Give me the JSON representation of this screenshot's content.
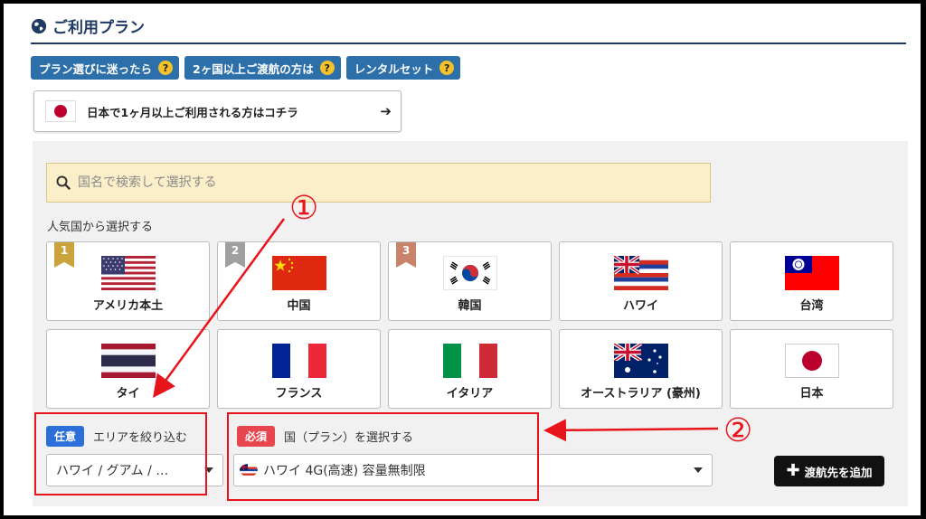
{
  "section": {
    "title": "ご利用プラン",
    "icon": "globe-icon"
  },
  "help_buttons": [
    {
      "label": "プラン選びに迷ったら",
      "icon": "question-icon"
    },
    {
      "label": "2ヶ国以上ご渡航の方は",
      "icon": "question-icon"
    },
    {
      "label": "レンタルセット",
      "icon": "question-icon"
    }
  ],
  "long_stay": {
    "label": "日本で1ヶ月以上ご利用される方はコチラ",
    "arrow": "➔"
  },
  "search": {
    "placeholder": "国名で検索して選択する",
    "icon": "search-icon"
  },
  "popular": {
    "label": "人気国から選択する",
    "countries": [
      {
        "name": "アメリカ本土",
        "rank": "1",
        "rank_color": "#c9a43c",
        "flag": "usa"
      },
      {
        "name": "中国",
        "rank": "2",
        "rank_color": "#a0a0a0",
        "flag": "china"
      },
      {
        "name": "韓国",
        "rank": "3",
        "rank_color": "#c8846a",
        "flag": "korea"
      },
      {
        "name": "ハワイ",
        "rank": "",
        "flag": "hawaii"
      },
      {
        "name": "台湾",
        "rank": "",
        "flag": "taiwan"
      },
      {
        "name": "タイ",
        "rank": "",
        "flag": "thailand"
      },
      {
        "name": "フランス",
        "rank": "",
        "flag": "france"
      },
      {
        "name": "イタリア",
        "rank": "",
        "flag": "italy"
      },
      {
        "name": "オーストラリア (豪州)",
        "rank": "",
        "flag": "australia"
      },
      {
        "name": "日本",
        "rank": "",
        "flag": "japan"
      }
    ]
  },
  "area": {
    "badge": "任意",
    "badge_color": "#2d6fd8",
    "label": "エリアを絞り込む",
    "value": "ハワイ / グアム / …"
  },
  "country": {
    "badge": "必須",
    "badge_color": "#e8464f",
    "label": "国（プラン）を選択する",
    "value": "ハワイ 4G(高速) 容量無制限"
  },
  "add_button": {
    "label": "渡航先を追加"
  },
  "annotations": {
    "marker1": "①",
    "marker2": "②",
    "color": "#e8141b"
  }
}
